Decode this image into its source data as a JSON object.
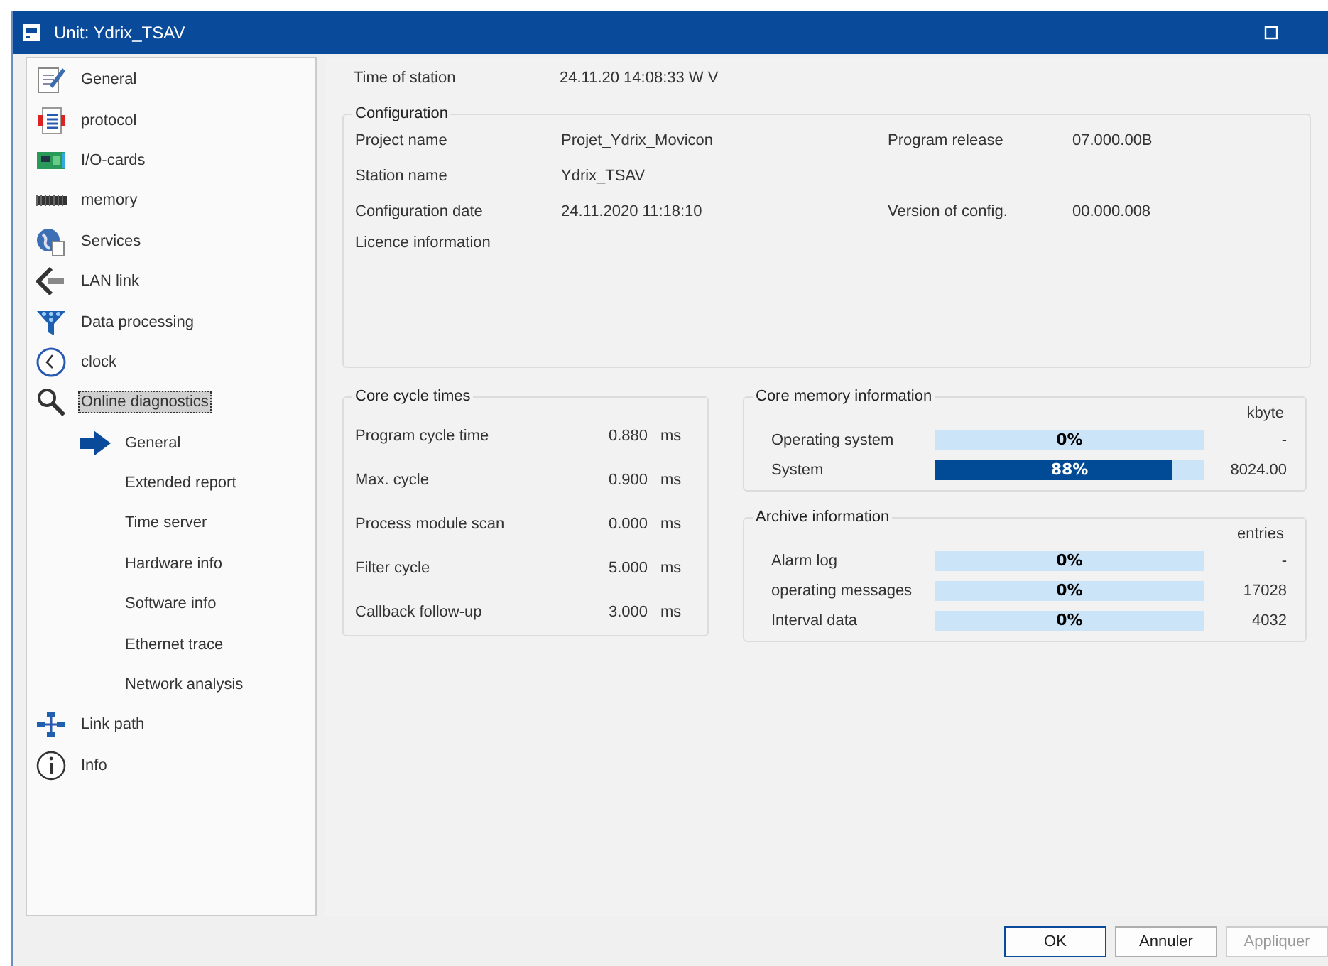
{
  "window": {
    "title": "Unit: Ydrix_TSAV"
  },
  "sidebar": {
    "items": [
      {
        "label": "General",
        "selected": false
      },
      {
        "label": "protocol",
        "selected": false
      },
      {
        "label": "I/O-cards",
        "selected": false
      },
      {
        "label": "memory",
        "selected": false
      },
      {
        "label": "Services",
        "selected": false
      },
      {
        "label": "LAN link",
        "selected": false
      },
      {
        "label": "Data processing",
        "selected": false
      },
      {
        "label": "clock",
        "selected": false
      },
      {
        "label": "Online diagnostics",
        "selected": true,
        "expanded": true,
        "children": [
          {
            "label": "General",
            "selected": true
          },
          {
            "label": "Extended report",
            "selected": false
          },
          {
            "label": "Time server",
            "selected": false
          },
          {
            "label": "Hardware info",
            "selected": false
          },
          {
            "label": "Software info",
            "selected": false
          },
          {
            "label": "Ethernet trace",
            "selected": false
          },
          {
            "label": "Network analysis",
            "selected": false
          }
        ]
      },
      {
        "label": "Link path",
        "selected": false
      },
      {
        "label": "Info",
        "selected": false
      }
    ]
  },
  "time_of_station": {
    "label": "Time of station",
    "value": "24.11.20 14:08:33 W V"
  },
  "configuration": {
    "title": "Configuration",
    "fields": [
      {
        "label": "Project name",
        "value": "Projet_Ydrix_Movicon",
        "label_2": "Program release",
        "value_2": "07.000.00B"
      },
      {
        "label": "Station name",
        "value": "Ydrix_TSAV"
      },
      {
        "label": "Configuration date",
        "value": "24.11.2020 11:18:10",
        "label_2": "Version of config.",
        "value_2": "00.000.008"
      },
      {
        "label": "Licence information"
      }
    ]
  },
  "core_cycle_times": {
    "title": "Core cycle times",
    "rows": [
      {
        "label": "Program cycle time",
        "value": "0.880",
        "unit": "ms"
      },
      {
        "label": "Max. cycle",
        "value": "0.900",
        "unit": "ms"
      },
      {
        "label": "Process module scan",
        "value": "0.000",
        "unit": "ms"
      },
      {
        "label": "Filter cycle",
        "value": "5.000",
        "unit": "ms"
      },
      {
        "label": "Callback follow-up",
        "value": "3.000",
        "unit": "ms"
      }
    ]
  },
  "core_memory": {
    "title": "Core memory information",
    "unit": "kbyte",
    "rows": [
      {
        "label": "Operating system",
        "level": 0,
        "percent": "0%",
        "value": "-"
      },
      {
        "label": "System",
        "level": 0.88,
        "percent": "88%",
        "value": "8024.00"
      }
    ]
  },
  "archive": {
    "title": "Archive information",
    "unit": "entries",
    "rows": [
      {
        "label": "Alarm log",
        "level": 0,
        "percent": "0%",
        "value": "-"
      },
      {
        "label": "operating messages",
        "level": 0,
        "percent": "0%",
        "value": "17028"
      },
      {
        "label": "Interval data",
        "level": 0,
        "percent": "0%",
        "value": "4032"
      }
    ]
  },
  "buttons": [
    {
      "label": "OK",
      "disabled": false,
      "default": true
    },
    {
      "label": "Annuler",
      "disabled": false,
      "default": false
    },
    {
      "label": "Appliquer",
      "disabled": true,
      "default": false
    }
  ]
}
